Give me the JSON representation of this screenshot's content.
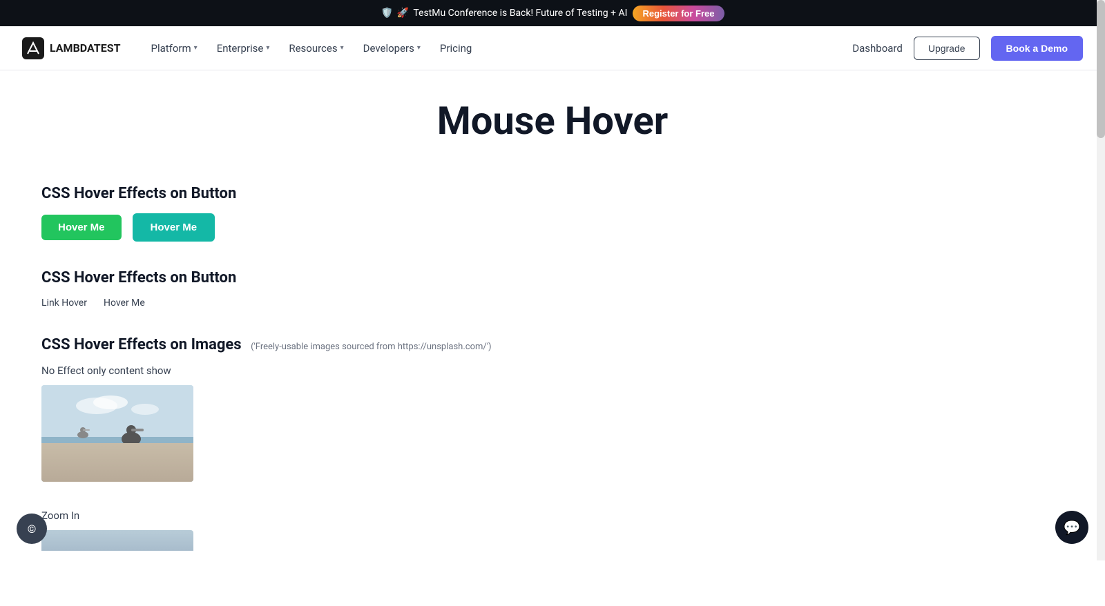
{
  "banner": {
    "icon1": "🛡️",
    "icon2": "🚀",
    "text": "TestMu Conference is Back! Future of Testing + AI",
    "register_btn": "Register for Free"
  },
  "navbar": {
    "logo_text": "LAMBDATEST",
    "nav_items": [
      {
        "label": "Platform",
        "has_dropdown": true
      },
      {
        "label": "Enterprise",
        "has_dropdown": true
      },
      {
        "label": "Resources",
        "has_dropdown": true
      },
      {
        "label": "Developers",
        "has_dropdown": true
      },
      {
        "label": "Pricing",
        "has_dropdown": false
      }
    ],
    "dashboard_label": "Dashboard",
    "upgrade_label": "Upgrade",
    "book_demo_label": "Book a Demo"
  },
  "main": {
    "page_title": "Mouse Hover",
    "sections": [
      {
        "id": "section-1",
        "title": "CSS Hover Effects on Button",
        "type": "buttons",
        "buttons": [
          {
            "label": "Hover Me",
            "style": "green"
          },
          {
            "label": "Hover Me",
            "style": "teal"
          }
        ]
      },
      {
        "id": "section-2",
        "title": "CSS Hover Effects on Button",
        "type": "links",
        "links": [
          {
            "label": "Link Hover"
          },
          {
            "label": "Hover Me"
          }
        ]
      },
      {
        "id": "section-3",
        "title": "CSS Hover Effects on Images",
        "subtitle": "('Freely-usable images sourced from https://unsplash.com/')",
        "type": "images",
        "subsections": [
          {
            "label": "No Effect only content show",
            "image_alt": "Pelican on pier"
          }
        ]
      }
    ],
    "zoom_in_label": "Zoom In"
  },
  "footer": {
    "chat_icon": "💬",
    "corner_icon": "©"
  }
}
